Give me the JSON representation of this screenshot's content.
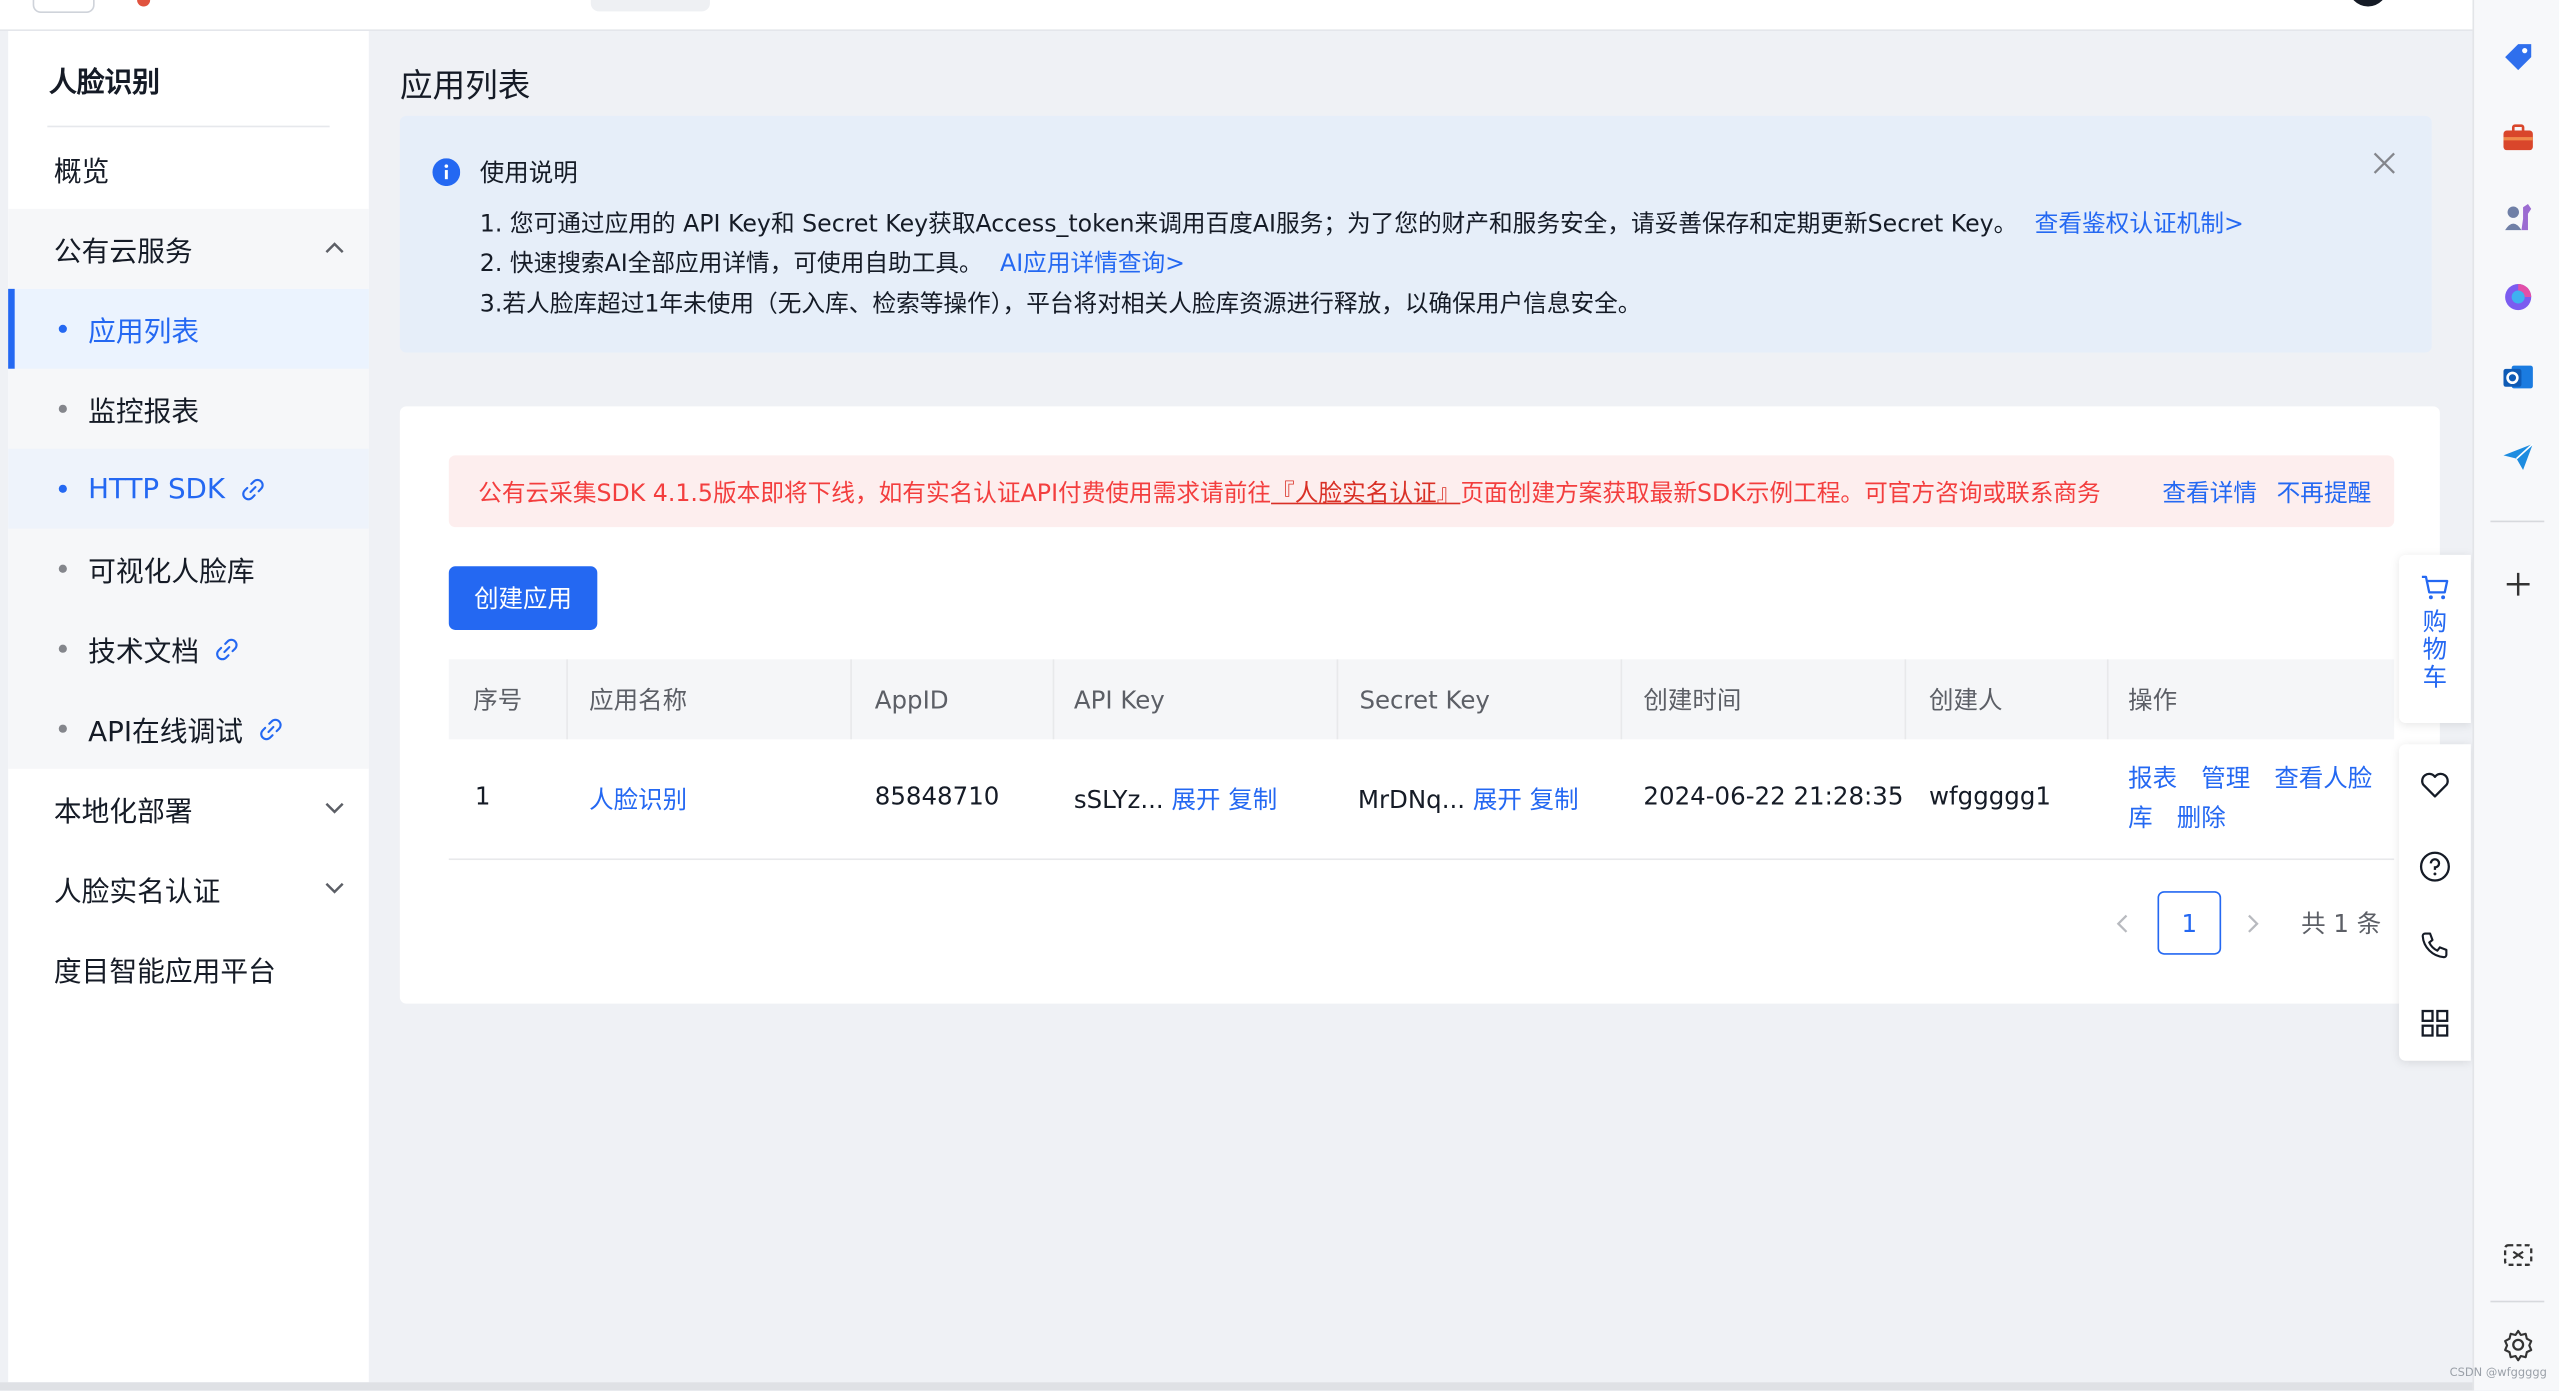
{
  "sidebar": {
    "title": "人脸识别",
    "overview": "概览",
    "public_cloud": "公有云服务",
    "sub_items": [
      {
        "label": "应用列表"
      },
      {
        "label": "监控报表"
      },
      {
        "label": "HTTP SDK"
      },
      {
        "label": "可视化人脸库"
      },
      {
        "label": "技术文档"
      },
      {
        "label": "API在线调试"
      }
    ],
    "local_deploy": "本地化部署",
    "real_name": "人脸实名认证",
    "dumu": "度目智能应用平台"
  },
  "main": {
    "title": "应用列表",
    "notice": {
      "title": "使用说明",
      "line1": "1. 您可通过应用的 API Key和 Secret Key获取Access_token来调用百度AI服务；为了您的财产和服务安全，请妥善保存和定期更新Secret Key。",
      "line1_link": "查看鉴权认证机制>",
      "line2": "2. 快速搜索AI全部应用详情，可使用自助工具。",
      "line2_link": "AI应用详情查询>",
      "line3": "3.若人脸库超过1年未使用（无入库、检索等操作），平台将对相关人脸库资源进行释放，以确保用户信息安全。"
    },
    "alert": {
      "text_before": "公有云采集SDK 4.1.5版本即将下线，如有实名认证API付费使用需求请前往",
      "text_link": "『人脸实名认证』",
      "text_after": "页面创建方案获取最新SDK示例工程。可官方咨询或联系商务",
      "view_details": "查看详情",
      "no_remind": "不再提醒"
    },
    "create_button": "创建应用",
    "table": {
      "headers": [
        "序号",
        "应用名称",
        "AppID",
        "API Key",
        "Secret Key",
        "创建时间",
        "创建人",
        "操作"
      ],
      "rows": [
        {
          "index": "1",
          "name": "人脸识别",
          "app_id": "85848710",
          "api_key": "sSLYz...",
          "secret_key": "MrDNq...",
          "expand": "展开",
          "copy": "复制",
          "created": "2024-06-22 21:28:35",
          "creator": "wfggggg1",
          "actions": {
            "report": "报表",
            "manage": "管理",
            "view_face_db_1": "查看人脸",
            "view_face_db_2": "库",
            "delete": "删除"
          }
        }
      ]
    },
    "pagination": {
      "current": "1",
      "total": "共 1 条"
    }
  },
  "floating": {
    "cart_label": "购物车"
  },
  "watermark": "CSDN @wfggggg",
  "colors": {
    "primary": "#2468f2",
    "danger": "#f33e3e",
    "notice_bg": "#e6eef9"
  }
}
